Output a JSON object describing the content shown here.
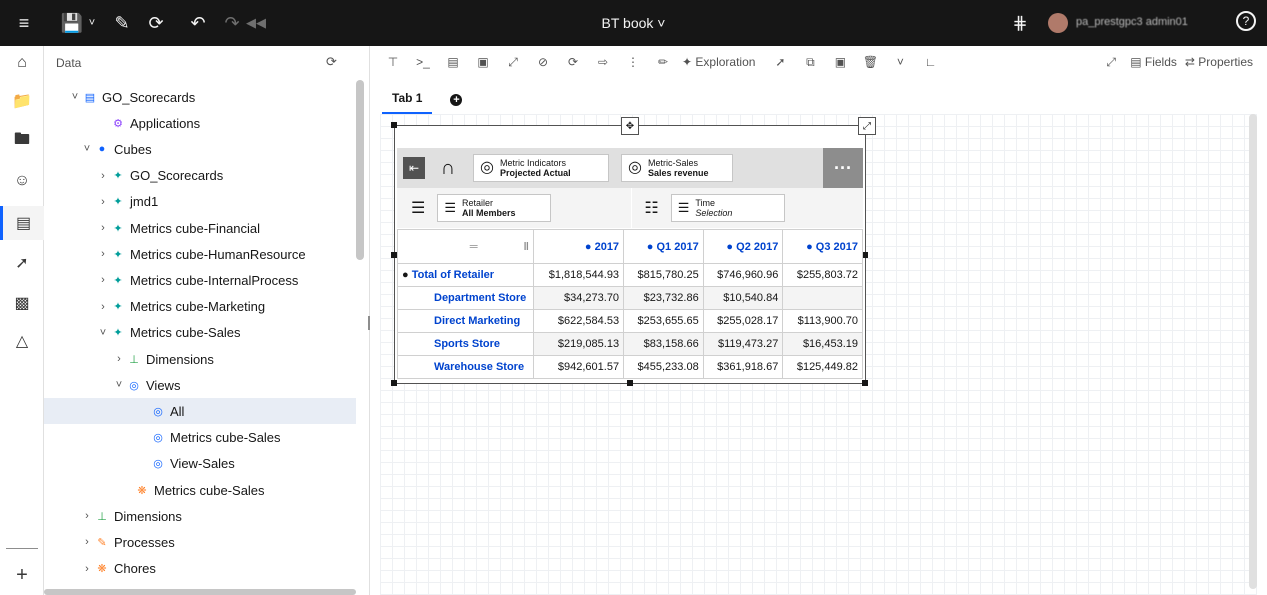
{
  "topbar": {
    "title": "BT book",
    "user_name": "pa_prestgpc3 admin01"
  },
  "panel": {
    "header": "Data",
    "tree": [
      {
        "label": "GO_Scorecards",
        "chev": "˅",
        "icon": "db"
      },
      {
        "label": "Applications",
        "chev": "",
        "icon": "app"
      },
      {
        "label": "Cubes",
        "chev": "˅",
        "icon": "cubes"
      },
      {
        "label": "GO_Scorecards",
        "chev": "›",
        "icon": "cube"
      },
      {
        "label": "jmd1",
        "chev": "›",
        "icon": "cube"
      },
      {
        "label": "Metrics cube-Financial",
        "chev": "›",
        "icon": "cube"
      },
      {
        "label": "Metrics cube-HumanResource",
        "chev": "›",
        "icon": "cube"
      },
      {
        "label": "Metrics cube-InternalProcess",
        "chev": "›",
        "icon": "cube"
      },
      {
        "label": "Metrics cube-Marketing",
        "chev": "›",
        "icon": "cube"
      },
      {
        "label": "Metrics cube-Sales",
        "chev": "˅",
        "icon": "cube"
      },
      {
        "label": "Dimensions",
        "chev": "›",
        "icon": "dim"
      },
      {
        "label": "Views",
        "chev": "˅",
        "icon": "view"
      },
      {
        "label": "All",
        "chev": "",
        "icon": "view",
        "selected": true
      },
      {
        "label": "Metrics cube-Sales",
        "chev": "",
        "icon": "view"
      },
      {
        "label": "View-Sales",
        "chev": "",
        "icon": "view"
      },
      {
        "label": "Metrics cube-Sales",
        "chev": "",
        "icon": "rule"
      },
      {
        "label": "Dimensions",
        "chev": "›",
        "icon": "dim"
      },
      {
        "label": "Processes",
        "chev": "›",
        "icon": "proc"
      },
      {
        "label": "Chores",
        "chev": "›",
        "icon": "chore"
      }
    ]
  },
  "toolbar": {
    "exploration": "Exploration",
    "fields": "Fields",
    "properties": "Properties"
  },
  "tabs": {
    "tab1": "Tab 1"
  },
  "widget": {
    "context1": {
      "title": "Metric Indicators",
      "value": "Projected Actual"
    },
    "context2": {
      "title": "Metric-Sales",
      "value": "Sales revenue"
    },
    "row_dim": {
      "title": "Retailer",
      "value": "All Members"
    },
    "col_dim": {
      "title": "Time",
      "value": "Selection"
    },
    "columns": [
      "2017",
      "Q1 2017",
      "Q2 2017",
      "Q3 2017"
    ],
    "rows": [
      {
        "label": "Total of Retailer",
        "values": [
          "$1,818,544.93",
          "$815,780.25",
          "$746,960.96",
          "$255,803.72"
        ]
      },
      {
        "label": "Department Store",
        "values": [
          "$34,273.70",
          "$23,732.86",
          "$10,540.84",
          ""
        ]
      },
      {
        "label": "Direct Marketing",
        "values": [
          "$622,584.53",
          "$253,655.65",
          "$255,028.17",
          "$113,900.70"
        ]
      },
      {
        "label": "Sports Store",
        "values": [
          "$219,085.13",
          "$83,158.66",
          "$119,473.27",
          "$16,453.19"
        ]
      },
      {
        "label": "Warehouse Store",
        "values": [
          "$942,601.57",
          "$455,233.08",
          "$361,918.67",
          "$125,449.82"
        ]
      }
    ]
  }
}
